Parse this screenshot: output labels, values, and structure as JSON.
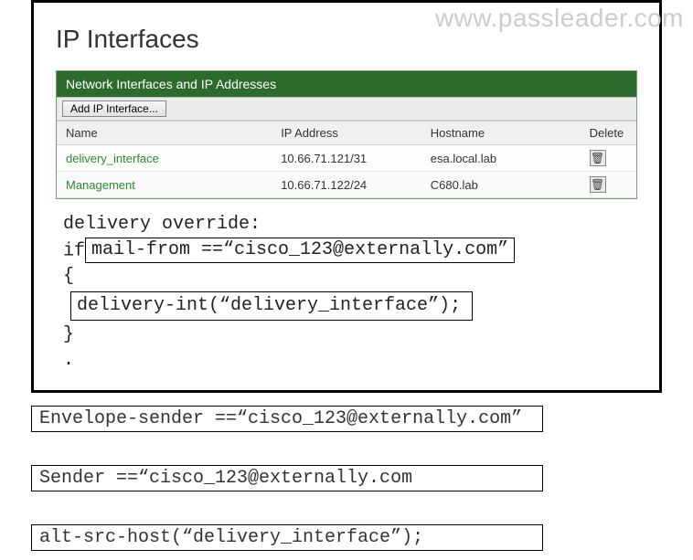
{
  "watermark": "www.passleader.com",
  "page_title": "IP Interfaces",
  "panel_header": "Network Interfaces and IP Addresses",
  "add_button": "Add IP Interface...",
  "columns": {
    "name": "Name",
    "ip": "IP Address",
    "host": "Hostname",
    "del": "Delete"
  },
  "rows": [
    {
      "name": "delivery_interface",
      "ip": "10.66.71.121/31",
      "host": "esa.local.lab"
    },
    {
      "name": "Management",
      "ip": "10.66.71.122/24",
      "host": "C680.lab"
    }
  ],
  "code": {
    "l1": "delivery override:",
    "l2_prefix": "if",
    "l2_box": "mail-from ==“cisco_123@externally.com”",
    "l3": "{",
    "l4_box": "delivery-int(“delivery_interface”);",
    "l5": "}",
    "l6": "."
  },
  "answers": {
    "a1": "Envelope-sender ==“cisco_123@externally.com”",
    "a2": "Sender ==“cisco_123@externally.com",
    "a3": "alt-src-host(“delivery_interface”);"
  }
}
